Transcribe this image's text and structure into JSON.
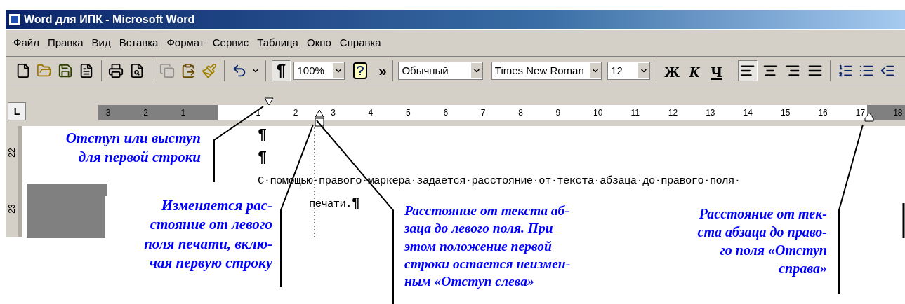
{
  "window": {
    "title": "Word для ИПК - Microsoft Word"
  },
  "menu": [
    {
      "label": "Файл"
    },
    {
      "label": "Правка"
    },
    {
      "label": "Вид"
    },
    {
      "label": "Вставка"
    },
    {
      "label": "Формат"
    },
    {
      "label": "Сервис"
    },
    {
      "label": "Таблица"
    },
    {
      "label": "Окно"
    },
    {
      "label": "Справка"
    }
  ],
  "toolbar": {
    "show_marks": {
      "label": "¶",
      "selected": true
    },
    "zoom": "100%",
    "more": "»",
    "style": "Обычный",
    "font": "Times New Roman",
    "size": "12",
    "format_buttons": [
      {
        "label": "Ж",
        "kind": "bold",
        "selected": false
      },
      {
        "label": "К",
        "kind": "italic",
        "selected": false
      },
      {
        "label": "Ч",
        "kind": "underline",
        "selected": false
      }
    ],
    "align_buttons": [
      {
        "kind": "left",
        "selected": true
      },
      {
        "kind": "center",
        "selected": false
      },
      {
        "kind": "right",
        "selected": false
      },
      {
        "kind": "justify",
        "selected": false
      }
    ]
  },
  "ruler": {
    "tab_button": "L",
    "labels": [
      {
        "text": "3",
        "in_margin": true
      },
      {
        "text": "2",
        "in_margin": true
      },
      {
        "text": "1",
        "in_margin": true
      },
      {
        "text": "1",
        "in_margin": false
      },
      {
        "text": "2",
        "in_margin": false
      },
      {
        "text": "3",
        "in_margin": false
      },
      {
        "text": "4",
        "in_margin": false
      },
      {
        "text": "5",
        "in_margin": false
      },
      {
        "text": "6",
        "in_margin": false
      },
      {
        "text": "7",
        "in_margin": false
      },
      {
        "text": "8",
        "in_margin": false
      },
      {
        "text": "9",
        "in_margin": false
      },
      {
        "text": "10",
        "in_margin": false
      },
      {
        "text": "11",
        "in_margin": false
      },
      {
        "text": "12",
        "in_margin": false
      },
      {
        "text": "13",
        "in_margin": false
      },
      {
        "text": "14",
        "in_margin": false
      },
      {
        "text": "15",
        "in_margin": false
      },
      {
        "text": "16",
        "in_margin": false
      },
      {
        "text": "17",
        "in_margin": false
      },
      {
        "text": "18",
        "in_margin": true
      }
    ]
  },
  "vertical_ruler": [
    "22",
    "23"
  ],
  "document": {
    "paragraphs": [
      {
        "kind": "empty",
        "mark": "¶"
      },
      {
        "kind": "empty",
        "mark": "¶"
      },
      {
        "kind": "text",
        "first_line": "С·помощью·правого·маркера·задается·расстояние·от·текста·абзаца·до·правого·поля·",
        "rest": "печати.",
        "mark": "¶"
      }
    ]
  },
  "callouts": [
    {
      "lines": [
        "Отступ или выступ",
        "для первой строки"
      ]
    },
    {
      "lines": [
        "Изменяется рас-",
        "стояние от левого",
        "поля печати, вклю-",
        "чая первую строку"
      ]
    },
    {
      "lines": [
        "Расстояние от текста аб-",
        "заца до левого поля. При",
        "этом положение первой",
        "строки остается неизмен-",
        "ным «Отступ слева»"
      ]
    },
    {
      "lines": [
        "Расстояние от тек-",
        "ста абзаца до право-",
        "го поля «Отступ",
        "справа»"
      ]
    }
  ]
}
